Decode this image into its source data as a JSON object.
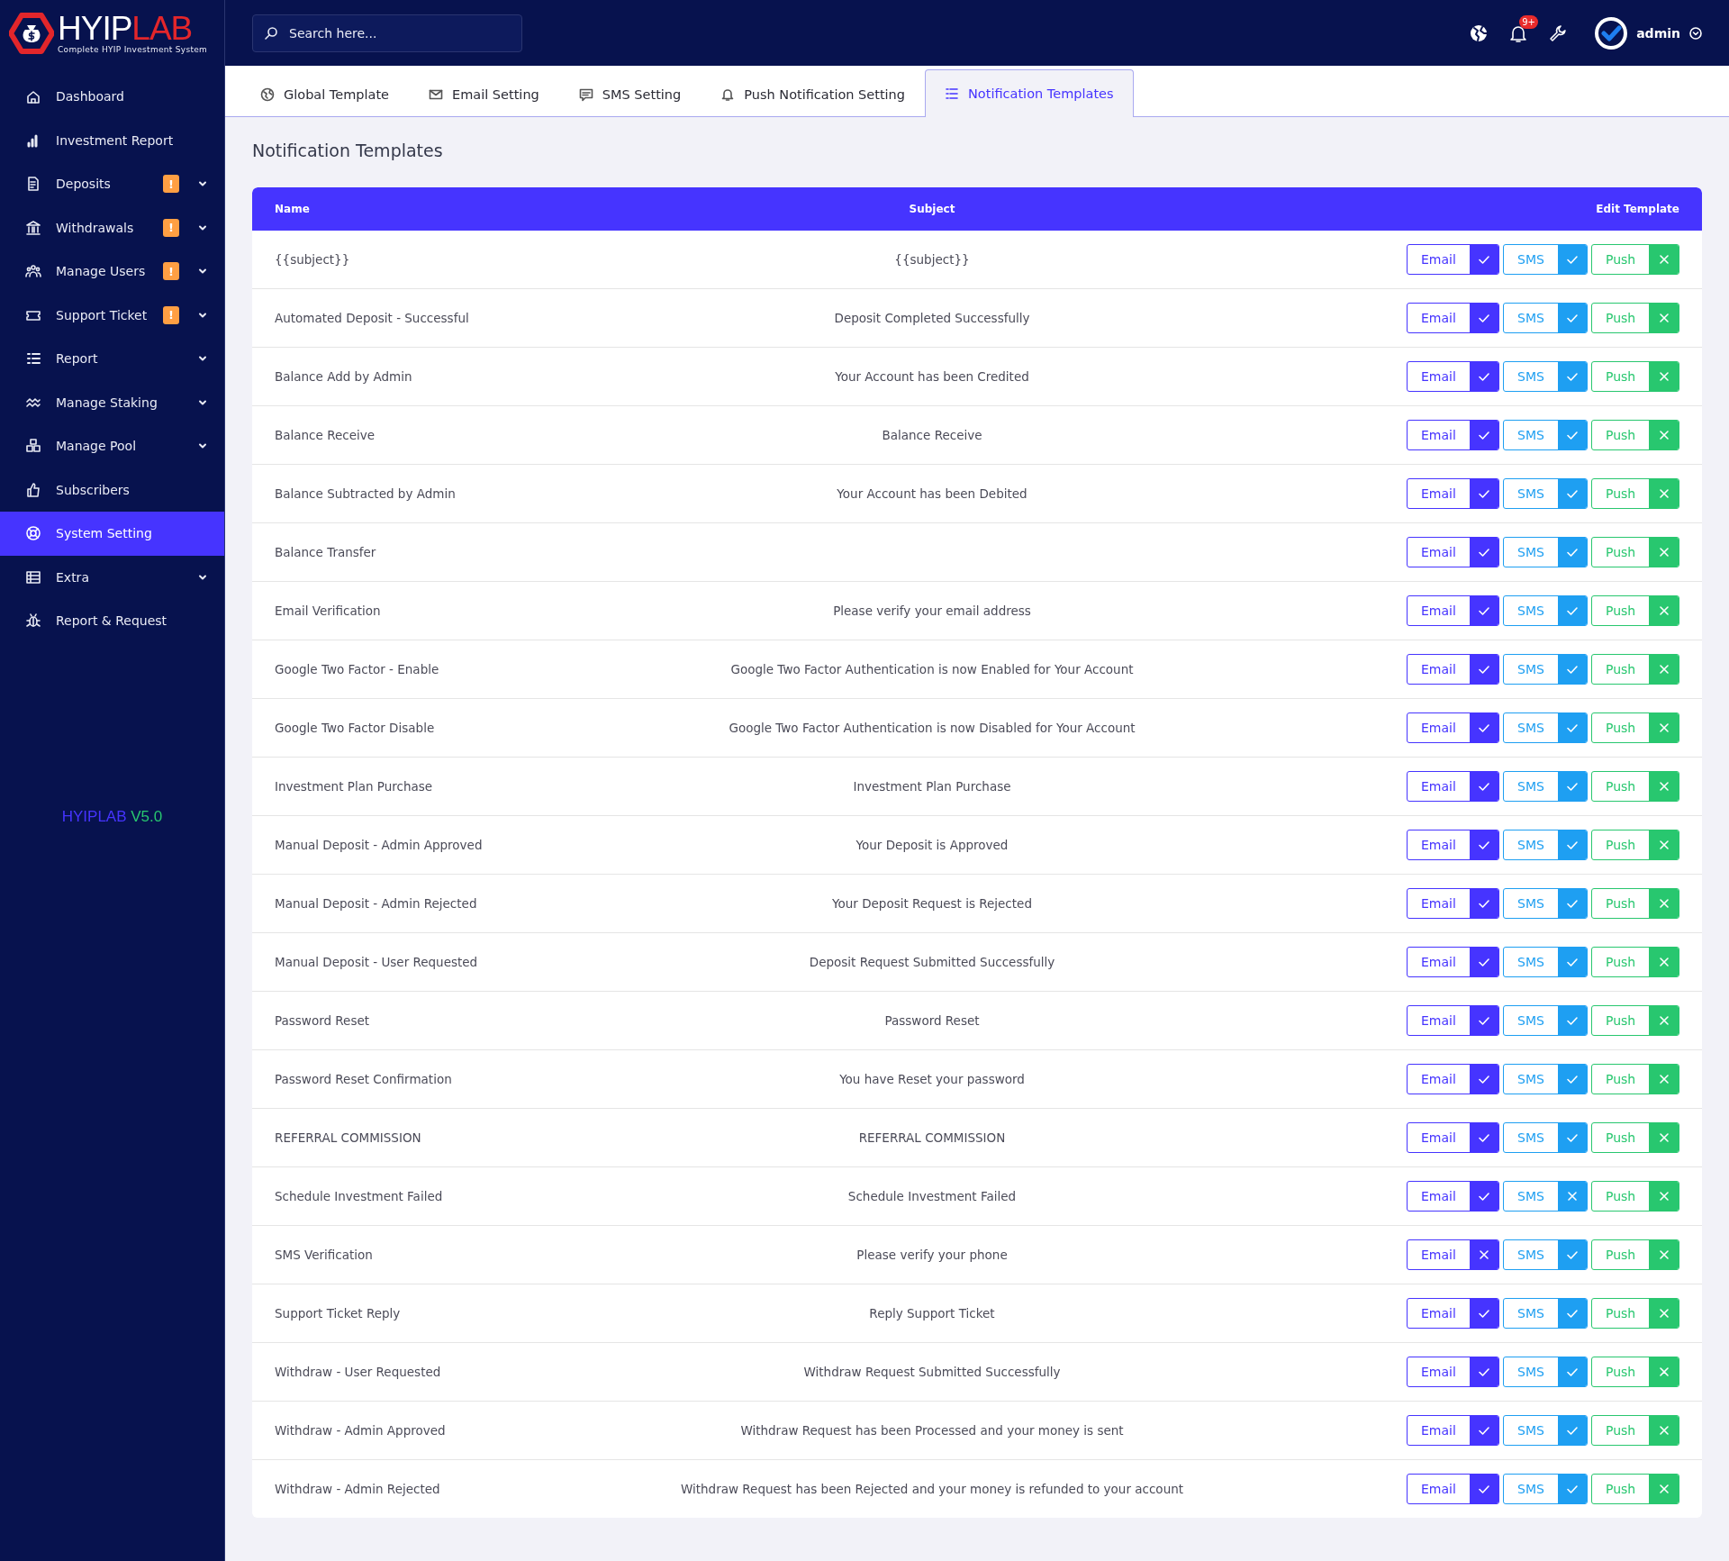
{
  "logo": {
    "primary": "HYIP",
    "accent": "LAB",
    "tagline": "Complete HYIP Investment System"
  },
  "sidebar": {
    "items": [
      {
        "label": "Dashboard",
        "has_submenu": false,
        "selected": false
      },
      {
        "label": "Investment Report",
        "has_submenu": false,
        "selected": false
      },
      {
        "label": "Deposits",
        "badge": "!",
        "has_submenu": true,
        "selected": false
      },
      {
        "label": "Withdrawals",
        "badge": "!",
        "has_submenu": true,
        "selected": false
      },
      {
        "label": "Manage Users",
        "badge": "!",
        "has_submenu": true,
        "selected": false
      },
      {
        "label": "Support Ticket",
        "badge": "!",
        "has_submenu": true,
        "selected": false
      },
      {
        "label": "Report",
        "has_submenu": true,
        "selected": false
      },
      {
        "label": "Manage Staking",
        "has_submenu": true,
        "selected": false
      },
      {
        "label": "Manage Pool",
        "has_submenu": true,
        "selected": false
      },
      {
        "label": "Subscribers",
        "has_submenu": false,
        "selected": false
      },
      {
        "label": "System Setting",
        "has_submenu": false,
        "selected": true
      },
      {
        "label": "Extra",
        "has_submenu": true,
        "selected": false
      },
      {
        "label": "Report & Request",
        "has_submenu": false,
        "selected": false
      }
    ],
    "version": {
      "name": "HYIPLAB",
      "number": "V5.0"
    }
  },
  "header": {
    "search": {
      "placeholder": "Search here..."
    },
    "notification_count": "9+",
    "user": "admin"
  },
  "tabs": [
    {
      "label": "Global Template",
      "selected": false
    },
    {
      "label": "Email Setting",
      "selected": false
    },
    {
      "label": "SMS Setting",
      "selected": false
    },
    {
      "label": "Push Notification Setting",
      "selected": false
    },
    {
      "label": "Notification Templates",
      "selected": true
    }
  ],
  "page_title": "Notification Templates",
  "table": {
    "columns": [
      "Name",
      "Subject",
      "Edit Template"
    ],
    "rows": [
      {
        "name": "{{subject}}",
        "subject": "{{subject}}",
        "toggles": [
          {
            "kind": "email",
            "label": "Email",
            "on": true
          },
          {
            "kind": "sms",
            "label": "SMS",
            "on": true
          },
          {
            "kind": "push",
            "label": "Push",
            "on": false
          }
        ]
      },
      {
        "name": "Automated Deposit - Successful",
        "subject": "Deposit Completed Successfully",
        "toggles": [
          {
            "kind": "email",
            "label": "Email",
            "on": true
          },
          {
            "kind": "sms",
            "label": "SMS",
            "on": true
          },
          {
            "kind": "push",
            "label": "Push",
            "on": false
          }
        ]
      },
      {
        "name": "Balance Add by Admin",
        "subject": "Your Account has been Credited",
        "toggles": [
          {
            "kind": "email",
            "label": "Email",
            "on": true
          },
          {
            "kind": "sms",
            "label": "SMS",
            "on": true
          },
          {
            "kind": "push",
            "label": "Push",
            "on": false
          }
        ]
      },
      {
        "name": "Balance Receive",
        "subject": "Balance Receive",
        "toggles": [
          {
            "kind": "email",
            "label": "Email",
            "on": true
          },
          {
            "kind": "sms",
            "label": "SMS",
            "on": true
          },
          {
            "kind": "push",
            "label": "Push",
            "on": false
          }
        ]
      },
      {
        "name": "Balance Subtracted by Admin",
        "subject": "Your Account has been Debited",
        "toggles": [
          {
            "kind": "email",
            "label": "Email",
            "on": true
          },
          {
            "kind": "sms",
            "label": "SMS",
            "on": true
          },
          {
            "kind": "push",
            "label": "Push",
            "on": false
          }
        ]
      },
      {
        "name": "Balance Transfer",
        "toggles": [
          {
            "kind": "email",
            "label": "Email",
            "on": true
          },
          {
            "kind": "sms",
            "label": "SMS",
            "on": true
          },
          {
            "kind": "push",
            "label": "Push",
            "on": false
          }
        ]
      },
      {
        "name": "Email Verification",
        "subject": "Please verify your email address",
        "toggles": [
          {
            "kind": "email",
            "label": "Email",
            "on": true
          },
          {
            "kind": "sms",
            "label": "SMS",
            "on": true
          },
          {
            "kind": "push",
            "label": "Push",
            "on": false
          }
        ]
      },
      {
        "name": "Google Two Factor - Enable",
        "subject": "Google Two Factor Authentication is now Enabled for Your Account",
        "toggles": [
          {
            "kind": "email",
            "label": "Email",
            "on": true
          },
          {
            "kind": "sms",
            "label": "SMS",
            "on": true
          },
          {
            "kind": "push",
            "label": "Push",
            "on": false
          }
        ]
      },
      {
        "name": "Google Two Factor Disable",
        "subject": "Google Two Factor Authentication is now Disabled for Your Account",
        "toggles": [
          {
            "kind": "email",
            "label": "Email",
            "on": true
          },
          {
            "kind": "sms",
            "label": "SMS",
            "on": true
          },
          {
            "kind": "push",
            "label": "Push",
            "on": false
          }
        ]
      },
      {
        "name": "Investment Plan Purchase",
        "subject": "Investment Plan Purchase",
        "toggles": [
          {
            "kind": "email",
            "label": "Email",
            "on": true
          },
          {
            "kind": "sms",
            "label": "SMS",
            "on": true
          },
          {
            "kind": "push",
            "label": "Push",
            "on": false
          }
        ]
      },
      {
        "name": "Manual Deposit - Admin Approved",
        "subject": "Your Deposit is Approved",
        "toggles": [
          {
            "kind": "email",
            "label": "Email",
            "on": true
          },
          {
            "kind": "sms",
            "label": "SMS",
            "on": true
          },
          {
            "kind": "push",
            "label": "Push",
            "on": false
          }
        ]
      },
      {
        "name": "Manual Deposit - Admin Rejected",
        "subject": "Your Deposit Request is Rejected",
        "toggles": [
          {
            "kind": "email",
            "label": "Email",
            "on": true
          },
          {
            "kind": "sms",
            "label": "SMS",
            "on": true
          },
          {
            "kind": "push",
            "label": "Push",
            "on": false
          }
        ]
      },
      {
        "name": "Manual Deposit - User Requested",
        "subject": "Deposit Request Submitted Successfully",
        "toggles": [
          {
            "kind": "email",
            "label": "Email",
            "on": true
          },
          {
            "kind": "sms",
            "label": "SMS",
            "on": true
          },
          {
            "kind": "push",
            "label": "Push",
            "on": false
          }
        ]
      },
      {
        "name": "Password Reset",
        "subject": "Password Reset",
        "toggles": [
          {
            "kind": "email",
            "label": "Email",
            "on": true
          },
          {
            "kind": "sms",
            "label": "SMS",
            "on": true
          },
          {
            "kind": "push",
            "label": "Push",
            "on": false
          }
        ]
      },
      {
        "name": "Password Reset Confirmation",
        "subject": "You have Reset your password",
        "toggles": [
          {
            "kind": "email",
            "label": "Email",
            "on": true
          },
          {
            "kind": "sms",
            "label": "SMS",
            "on": true
          },
          {
            "kind": "push",
            "label": "Push",
            "on": false
          }
        ]
      },
      {
        "name": "REFERRAL COMMISSION",
        "subject": "REFERRAL COMMISSION",
        "toggles": [
          {
            "kind": "email",
            "label": "Email",
            "on": true
          },
          {
            "kind": "sms",
            "label": "SMS",
            "on": true
          },
          {
            "kind": "push",
            "label": "Push",
            "on": false
          }
        ]
      },
      {
        "name": "Schedule Investment Failed",
        "subject": "Schedule Investment Failed",
        "toggles": [
          {
            "kind": "email",
            "label": "Email",
            "on": true
          },
          {
            "kind": "sms",
            "label": "SMS",
            "on": false
          },
          {
            "kind": "push",
            "label": "Push",
            "on": false
          }
        ]
      },
      {
        "name": "SMS Verification",
        "subject": "Please verify your phone",
        "toggles": [
          {
            "kind": "email",
            "label": "Email",
            "on": false
          },
          {
            "kind": "sms",
            "label": "SMS",
            "on": true
          },
          {
            "kind": "push",
            "label": "Push",
            "on": false
          }
        ]
      },
      {
        "name": "Support Ticket Reply",
        "subject": "Reply Support Ticket",
        "toggles": [
          {
            "kind": "email",
            "label": "Email",
            "on": true
          },
          {
            "kind": "sms",
            "label": "SMS",
            "on": true
          },
          {
            "kind": "push",
            "label": "Push",
            "on": false
          }
        ]
      },
      {
        "name": "Withdraw  - User Requested",
        "subject": "Withdraw Request Submitted Successfully",
        "toggles": [
          {
            "kind": "email",
            "label": "Email",
            "on": true
          },
          {
            "kind": "sms",
            "label": "SMS",
            "on": true
          },
          {
            "kind": "push",
            "label": "Push",
            "on": false
          }
        ]
      },
      {
        "name": "Withdraw - Admin  Approved",
        "subject": "Withdraw Request has been Processed and your money is sent",
        "toggles": [
          {
            "kind": "email",
            "label": "Email",
            "on": true
          },
          {
            "kind": "sms",
            "label": "SMS",
            "on": true
          },
          {
            "kind": "push",
            "label": "Push",
            "on": false
          }
        ]
      },
      {
        "name": "Withdraw - Admin Rejected",
        "subject": "Withdraw Request has been Rejected and your money is refunded to your account",
        "toggles": [
          {
            "kind": "email",
            "label": "Email",
            "on": true
          },
          {
            "kind": "sms",
            "label": "SMS",
            "on": true
          },
          {
            "kind": "push",
            "label": "Push",
            "on": false
          }
        ]
      }
    ]
  }
}
